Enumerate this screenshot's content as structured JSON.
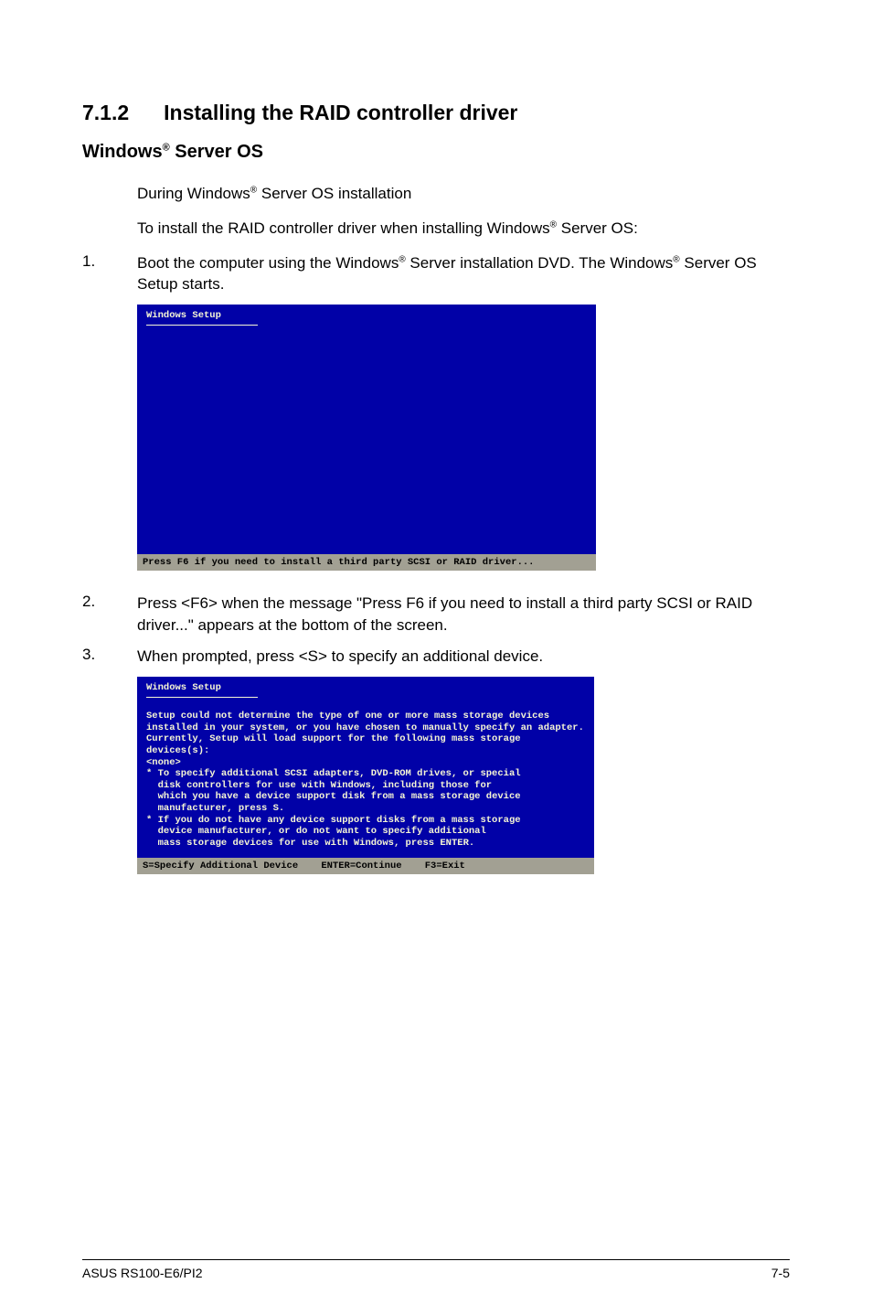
{
  "section": {
    "number": "7.1.2",
    "title": "Installing the RAID controller driver"
  },
  "subheading": {
    "prefix": "Windows",
    "reg": "®",
    "suffix": " Server OS"
  },
  "intro1": {
    "prefix": "During Windows",
    "reg": "®",
    "suffix": " Server OS installation"
  },
  "intro2": {
    "prefix": "To install the RAID controller driver when installing Windows",
    "reg": "®",
    "suffix": " Server OS:"
  },
  "step1": {
    "n": "1.",
    "l1_prefix": "Boot the computer using the Windows",
    "l1_reg": "®",
    "l1_suffix": " Server installation DVD. The ",
    "l2_prefix": "Windows",
    "l2_reg": "®",
    "l2_suffix": " Server OS Setup starts."
  },
  "shot1": {
    "title": "Windows Setup",
    "status": "Press F6 if you need to install a third party SCSI or RAID driver..."
  },
  "step2": {
    "n": "2.",
    "text": "Press <F6> when the message \"Press F6 if you need to install a third party SCSI or RAID driver...\" appears at the bottom of the screen."
  },
  "step3": {
    "n": "3.",
    "text": "When prompted, press <S> to specify an additional device."
  },
  "shot2": {
    "title": "Windows Setup",
    "para": "Setup could not determine the type of one or more mass storage devices installed in your system, or you have chosen to manually specify an adapter. Currently, Setup will load support for the following mass storage devices(s):",
    "none": "<none>",
    "b1": "* To specify additional SCSI adapters, DVD-ROM drives, or special\n  disk controllers for use with Windows, including those for\n  which you have a device support disk from a mass storage device\n  manufacturer, press S.",
    "b2": "* If you do not have any device support disks from a mass storage\n  device manufacturer, or do not want to specify additional\n  mass storage devices for use with Windows, press ENTER.",
    "status": "S=Specify Additional Device    ENTER=Continue    F3=Exit"
  },
  "footer": {
    "left": "ASUS RS100-E6/PI2",
    "right": "7-5"
  }
}
